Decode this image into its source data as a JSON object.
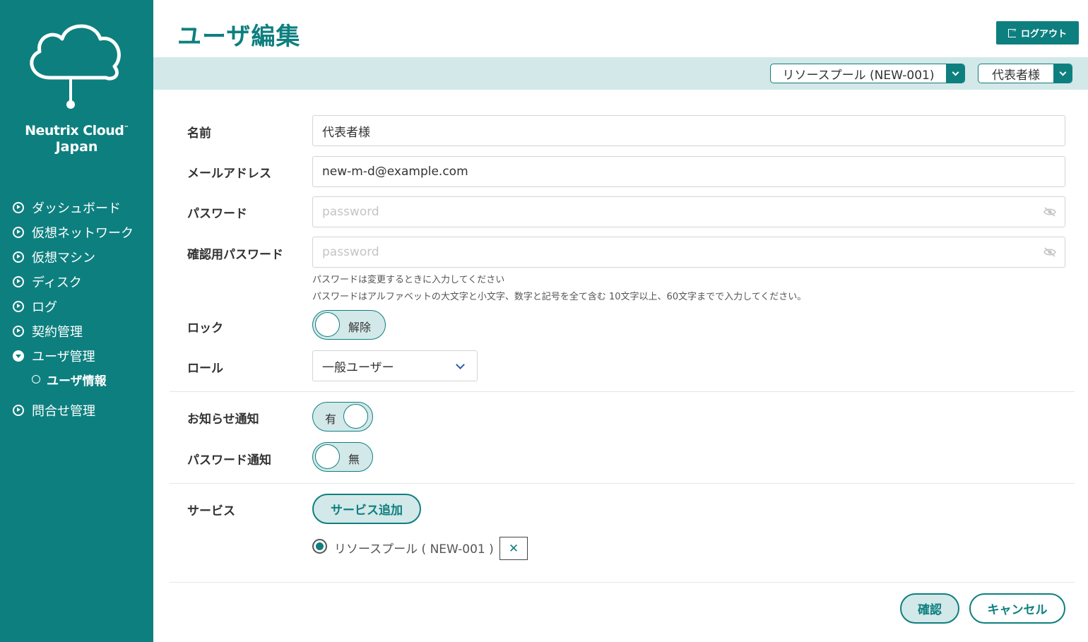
{
  "brand": {
    "name": "Neutrix Cloud",
    "tm": "™",
    "region": "Japan"
  },
  "sidebar": {
    "items": [
      {
        "label": "ダッシュボード"
      },
      {
        "label": "仮想ネットワーク"
      },
      {
        "label": "仮想マシン"
      },
      {
        "label": "ディスク"
      },
      {
        "label": "ログ"
      },
      {
        "label": "契約管理"
      },
      {
        "label": "ユーザ管理"
      },
      {
        "label": "問合せ管理"
      }
    ],
    "sub_item": {
      "label": "ユーザ情報"
    }
  },
  "header": {
    "title": "ユーザ編集",
    "logout_label": "ログアウト",
    "pool_select": "リソースプール (NEW-001)",
    "user_select": "代表者様"
  },
  "form": {
    "name_label": "名前",
    "name_value": "代表者様",
    "email_label": "メールアドレス",
    "email_value": "new-m-d@example.com",
    "password_label": "パスワード",
    "password_placeholder": "password",
    "confirm_password_label": "確認用パスワード",
    "confirm_password_placeholder": "password",
    "hint1": "パスワードは変更するときに入力してください",
    "hint2": "パスワードはアルファベットの大文字と小文字、数字と記号を全て含む 10文字以上、60文字までで入力してください。",
    "lock_label": "ロック",
    "lock_toggle": "解除",
    "role_label": "ロール",
    "role_value": "一般ユーザー",
    "notice_label": "お知らせ通知",
    "notice_toggle": "有",
    "pw_notice_label": "パスワード通知",
    "pw_notice_toggle": "無",
    "service_label": "サービス",
    "add_service_label": "サービス追加",
    "service_item": "リソースプール ( NEW-001 )",
    "remove_label": "✕"
  },
  "actions": {
    "confirm_label": "確認",
    "cancel_label": "キャンセル"
  },
  "colors": {
    "primary": "#0e7f7f",
    "primary_light": "#d3e8e9"
  }
}
